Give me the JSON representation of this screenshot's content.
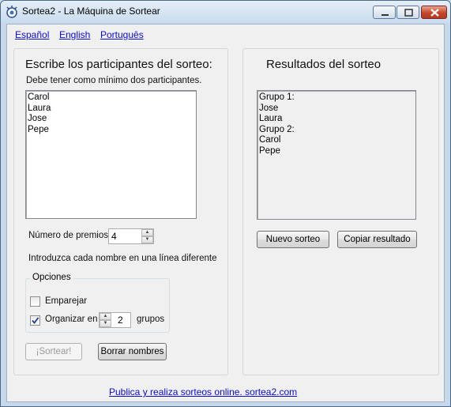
{
  "window": {
    "title": "Sortea2 - La Máquina de Sortear"
  },
  "languages": [
    "Español",
    "English",
    "Português"
  ],
  "left_panel": {
    "heading": "Escribe los participantes del sorteo:",
    "hint": "Debe tener como mínimo dos participantes.",
    "participants": [
      "Carol",
      "Laura",
      "Jose",
      "Pepe"
    ],
    "prizes_label": "Número de premios:",
    "prizes_value": "4",
    "instruction": "Introduzca cada nombre en una línea diferente",
    "options_title": "Opciones",
    "pair_label": "Emparejar",
    "pair_checked": false,
    "organize_label": "Organizar en",
    "organize_checked": true,
    "groups_value": "2",
    "groups_label": "grupos",
    "draw_button": "¡Sortear!",
    "clear_button": "Borrar nombres"
  },
  "right_panel": {
    "heading": "Resultados del sorteo",
    "results": [
      "Grupo 1:",
      "Jose",
      "Laura",
      "Grupo 2:",
      "Carol",
      "Pepe"
    ],
    "new_button": "Nuevo sorteo",
    "copy_button": "Copiar resultado"
  },
  "footer_link": "Publica y realiza sorteos online.  sortea2.com"
}
